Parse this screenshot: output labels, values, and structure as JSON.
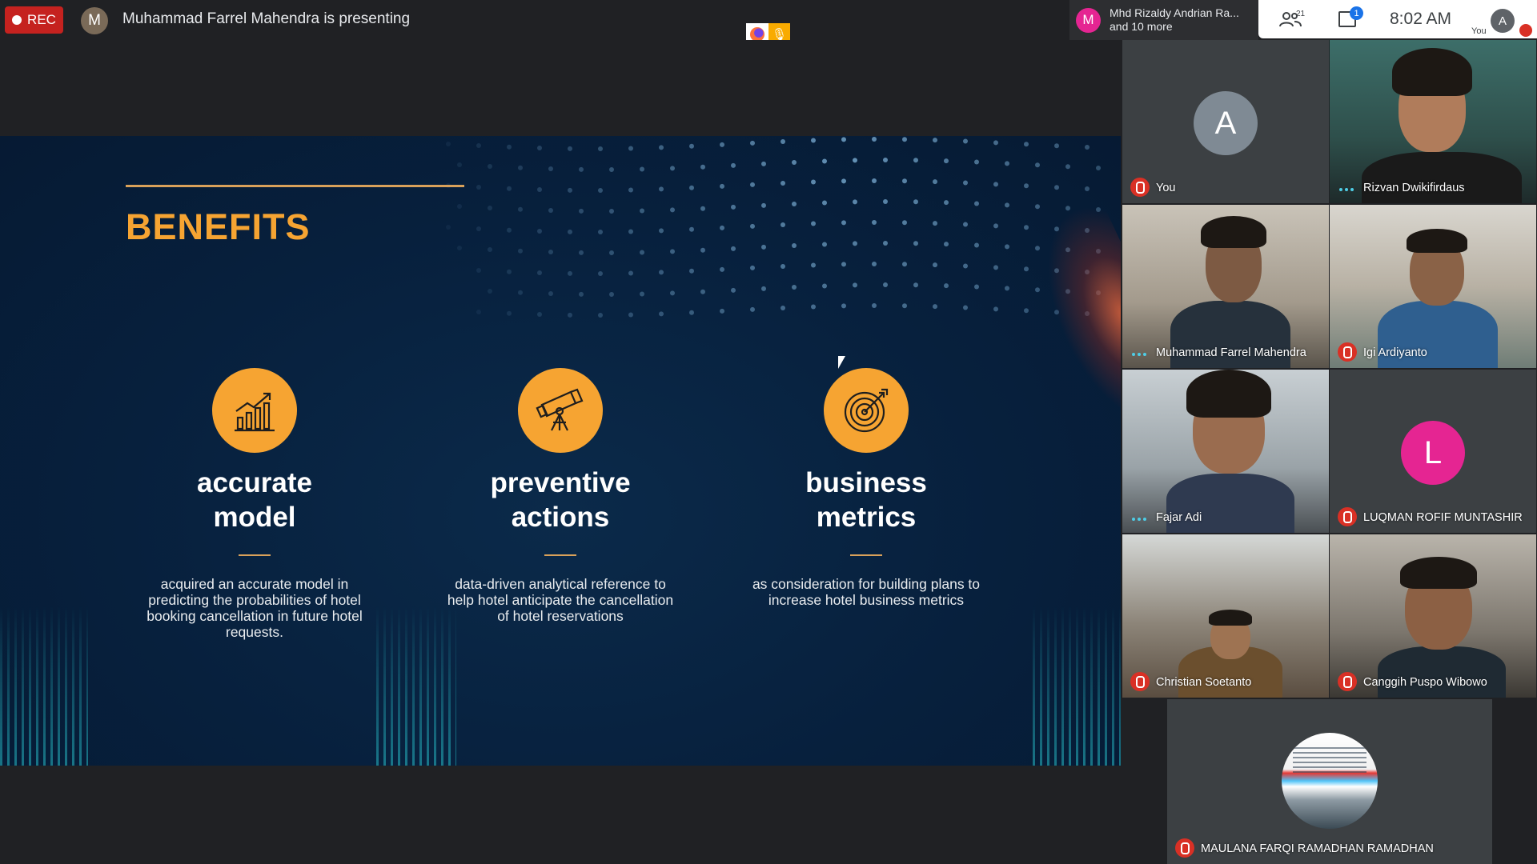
{
  "topbar": {
    "rec_label": "REC",
    "presenter_initial": "M",
    "presenting_text": "Muhammad Farrel Mahendra is presenting"
  },
  "notification": {
    "avatar_initial": "M",
    "line1": "Mhd Rizaldy Andrian Ra...",
    "line2": "and 10 more",
    "avatar_color": "#e52592"
  },
  "controls": {
    "people_count": "21",
    "chat_badge": "1",
    "time": "8:02  AM",
    "self_initial": "A",
    "self_label": "You"
  },
  "slide": {
    "title": "BENEFITS",
    "accent_color": "#f6a432",
    "features": [
      {
        "icon": "growth-chart-icon",
        "title_line1": "accurate",
        "title_line2": "model",
        "description": "acquired an accurate model in predicting the probabilities of hotel booking cancellation in future hotel requests."
      },
      {
        "icon": "telescope-icon",
        "title_line1": "preventive",
        "title_line2": "actions",
        "description": "data-driven analytical reference to help hotel anticipate the cancellation of hotel reservations"
      },
      {
        "icon": "target-icon",
        "title_line1": "business",
        "title_line2": "metrics",
        "description": "as consideration for building plans to increase hotel business metrics"
      }
    ]
  },
  "participants": [
    {
      "name": "You",
      "initial": "A",
      "avatar_color": "#7f8a94",
      "status": "muted",
      "video": false
    },
    {
      "name": "Rizvan Dwikifirdaus",
      "status": "speaking",
      "video": true
    },
    {
      "name": "Muhammad Farrel Mahendra",
      "status": "speaking",
      "video": true
    },
    {
      "name": "Igi Ardiyanto",
      "status": "muted",
      "video": true
    },
    {
      "name": "Fajar Adi",
      "status": "speaking",
      "video": true
    },
    {
      "name": "LUQMAN ROFIF MUNTASHIR",
      "initial": "L",
      "avatar_color": "#e52592",
      "status": "muted",
      "video": false
    },
    {
      "name": "Christian Soetanto",
      "status": "muted",
      "video": true
    },
    {
      "name": "Canggih Puspo Wibowo",
      "status": "muted",
      "video": true
    },
    {
      "name": "MAULANA FARQI RAMADHAN RAMADHAN",
      "status": "muted",
      "video": false
    }
  ]
}
